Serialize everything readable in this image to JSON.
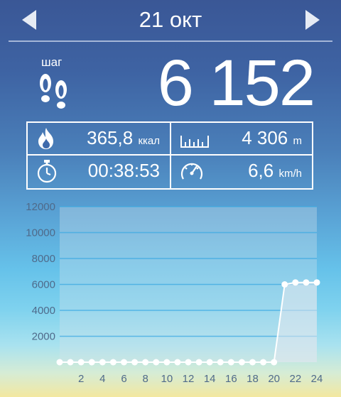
{
  "header": {
    "date": "21 окт"
  },
  "steps": {
    "label": "шаг",
    "value": "6 152"
  },
  "stats": {
    "calories_value": "365,8",
    "calories_unit": "ккал",
    "distance_value": "4 306",
    "distance_unit": "m",
    "time_value": "00:38:53",
    "speed_value": "6,6",
    "speed_unit": "km/h"
  },
  "chart_data": {
    "type": "area",
    "x": [
      0,
      1,
      2,
      3,
      4,
      5,
      6,
      7,
      8,
      9,
      10,
      11,
      12,
      13,
      14,
      15,
      16,
      17,
      18,
      19,
      20,
      21,
      22,
      23,
      24
    ],
    "values": [
      0,
      0,
      0,
      0,
      0,
      0,
      0,
      0,
      0,
      0,
      0,
      0,
      0,
      0,
      0,
      0,
      0,
      0,
      0,
      0,
      0,
      6000,
      6152,
      6152,
      6152
    ],
    "x_ticks": [
      "2",
      "4",
      "6",
      "8",
      "10",
      "12",
      "14",
      "16",
      "18",
      "20",
      "22",
      "24"
    ],
    "y_ticks": [
      "2000",
      "4000",
      "6000",
      "8000",
      "10000",
      "12000"
    ],
    "ylim": [
      0,
      12000
    ],
    "xlim": [
      0,
      24
    ],
    "grid": true
  }
}
